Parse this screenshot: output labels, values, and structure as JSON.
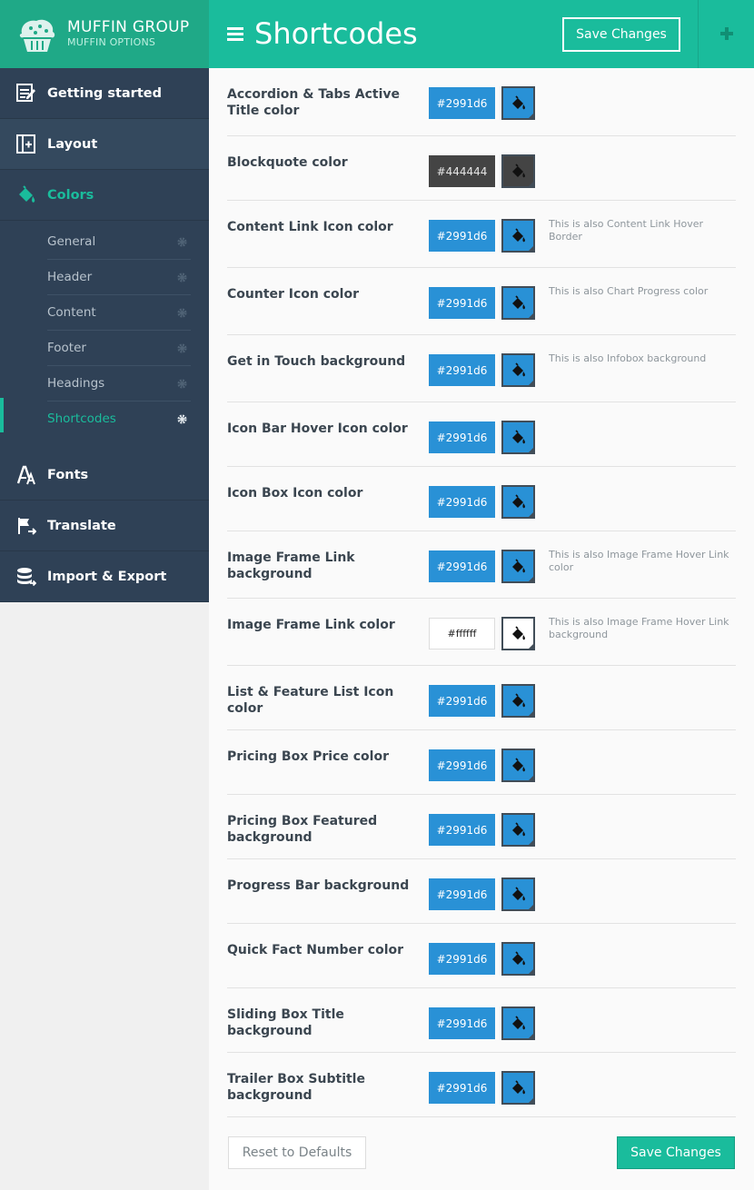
{
  "brand": {
    "name": "MUFFIN GROUP",
    "subtitle": "MUFFIN OPTIONS"
  },
  "header": {
    "title": "Shortcodes",
    "save_label": "Save Changes"
  },
  "sidebar": {
    "main": [
      {
        "label": "Getting started",
        "icon": "edit-icon"
      },
      {
        "label": "Layout",
        "icon": "layout-icon"
      },
      {
        "label": "Colors",
        "icon": "paint-bucket-icon"
      },
      {
        "label": "Fonts",
        "icon": "font-icon"
      },
      {
        "label": "Translate",
        "icon": "flag-icon"
      },
      {
        "label": "Import & Export",
        "icon": "database-icon"
      }
    ],
    "sub": [
      {
        "label": "General"
      },
      {
        "label": "Header"
      },
      {
        "label": "Content"
      },
      {
        "label": "Footer"
      },
      {
        "label": "Headings"
      },
      {
        "label": "Shortcodes"
      }
    ]
  },
  "rows": [
    {
      "label": "Accordion & Tabs Active Title color",
      "value": "#2991d6",
      "hint": ""
    },
    {
      "label": "Blockquote color",
      "value": "#444444",
      "hint": ""
    },
    {
      "label": "Content Link Icon color",
      "value": "#2991d6",
      "hint": "This is also Content Link Hover Border"
    },
    {
      "label": "Counter Icon color",
      "value": "#2991d6",
      "hint": "This is also Chart Progress color"
    },
    {
      "label": "Get in Touch background",
      "value": "#2991d6",
      "hint": "This is also Infobox background"
    },
    {
      "label": "Icon Bar Hover Icon color",
      "value": "#2991d6",
      "hint": ""
    },
    {
      "label": "Icon Box Icon color",
      "value": "#2991d6",
      "hint": ""
    },
    {
      "label": "Image Frame Link background",
      "value": "#2991d6",
      "hint": "This is also Image Frame Hover Link color"
    },
    {
      "label": "Image Frame Link color",
      "value": "#ffffff",
      "hint": "This is also Image Frame Hover Link background"
    },
    {
      "label": "List & Feature List Icon color",
      "value": "#2991d6",
      "hint": ""
    },
    {
      "label": "Pricing Box Price color",
      "value": "#2991d6",
      "hint": ""
    },
    {
      "label": "Pricing Box Featured background",
      "value": "#2991d6",
      "hint": ""
    },
    {
      "label": "Progress Bar background",
      "value": "#2991d6",
      "hint": ""
    },
    {
      "label": "Quick Fact Number color",
      "value": "#2991d6",
      "hint": ""
    },
    {
      "label": "Sliding Box Title background",
      "value": "#2991d6",
      "hint": ""
    },
    {
      "label": "Trailer Box Subtitle background",
      "value": "#2991d6",
      "hint": ""
    }
  ],
  "footer": {
    "reset_label": "Reset to Defaults",
    "save_label": "Save Changes"
  },
  "colors": {
    "accent": "#1abc9c",
    "sidebar": "#2f4156",
    "picker_border": "#414d58"
  }
}
